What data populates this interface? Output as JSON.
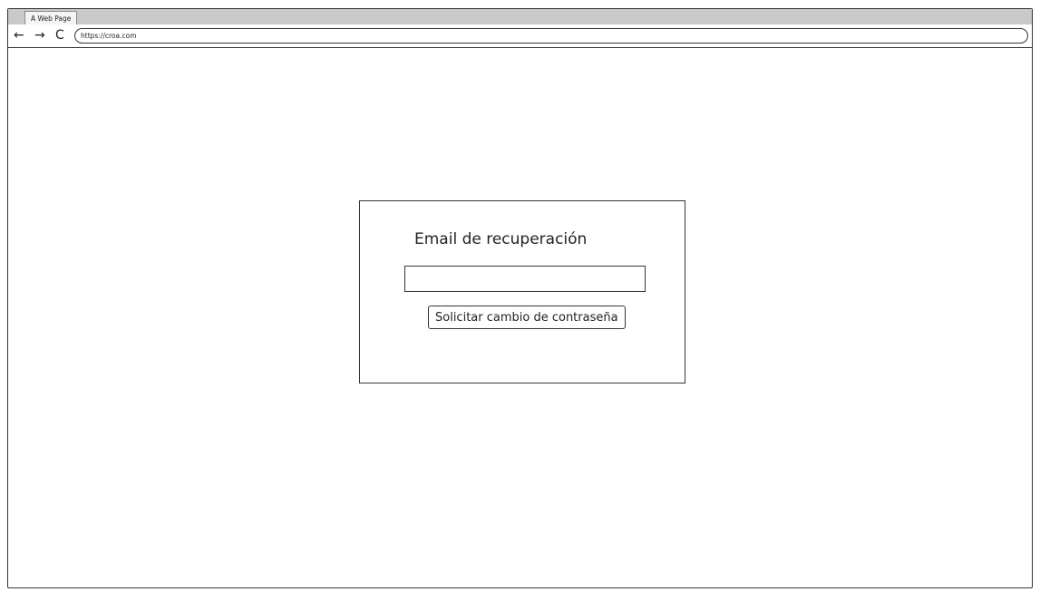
{
  "browser": {
    "tab_title": "A Web Page",
    "url": "https://croa.com",
    "back_icon": "←",
    "forward_icon": "→",
    "reload_icon": "C"
  },
  "recovery_form": {
    "title": "Email de recuperación",
    "email_value": "",
    "email_placeholder": "",
    "submit_label": "Solicitar cambio de contraseña"
  }
}
